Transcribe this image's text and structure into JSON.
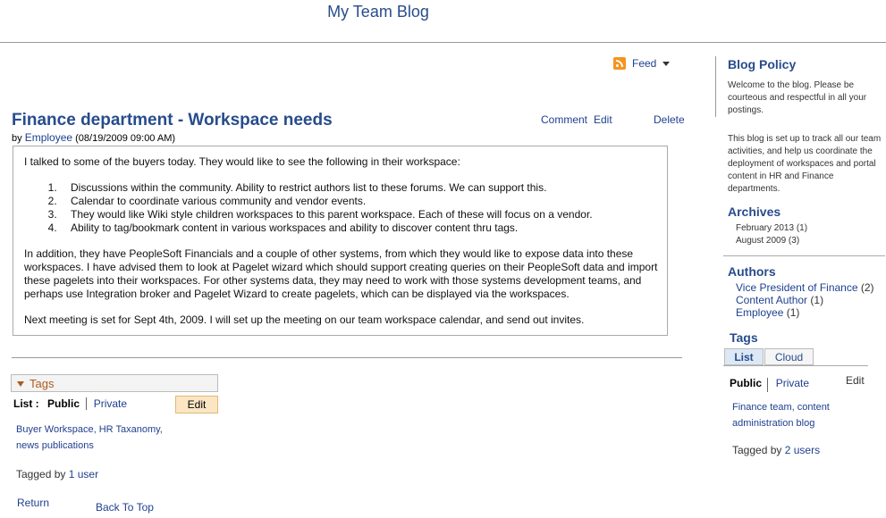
{
  "page": {
    "title": "My Team Blog"
  },
  "feed": {
    "label": "Feed"
  },
  "post": {
    "title": "Finance department - Workspace needs",
    "actions": {
      "comment": "Comment",
      "edit": "Edit",
      "delete": "Delete"
    },
    "byline": {
      "prefix": "by",
      "author": "Employee",
      "date": "(08/19/2009 09:00 AM)"
    },
    "body": {
      "intro": "I talked to some of the buyers today. They would like to see the following in their workspace:",
      "items": [
        "Discussions within the community. Ability to restrict authors list to these forums. We can support this.",
        "Calendar to coordinate various community and vendor events.",
        "They would like Wiki style children workspaces to this parent workspace. Each of these will focus on a vendor.",
        "Ability to tag/bookmark content in various workspaces and ability to discover content thru tags."
      ],
      "para2": "In addition, they have PeopleSoft Financials and a couple of other systems, from which they would like to expose data into these workspaces. I have advised them to look at Pagelet wizard which should support creating queries on their PeopleSoft data and import these pagelets into their workspaces. For other systems data, they may need to work with those systems development teams, and perhaps use Integration broker  and Pagelet Wizard to create pagelets, which can be displayed via the workspaces.",
      "para3": "Next meeting is set for Sept 4th, 2009. I will set up the meeting on our team workspace calendar, and send out invites."
    }
  },
  "tags": {
    "header": "Tags",
    "list_label": "List :",
    "public": "Public",
    "private": "Private",
    "edit": "Edit",
    "links": [
      "Buyer Workspace",
      "HR Taxanomy",
      "news publications"
    ],
    "tagged_prefix": "Tagged by",
    "tagged_link": "1 user"
  },
  "nav": {
    "return": "Return",
    "back_to_top": "Back To Top"
  },
  "rail": {
    "policy": {
      "title": "Blog Policy",
      "p1": "Welcome to the blog.  Please be courteous and respectful in all your postings.",
      "p2": "This blog is set up to track all our team activities, and help us coordinate the deployment of workspaces and portal content in HR and Finance departments."
    },
    "archives": {
      "title": "Archives",
      "items": [
        "February 2013 (1)",
        "August 2009 (3)"
      ]
    },
    "authors": {
      "title": "Authors",
      "items": [
        {
          "name": "Vice President of Finance",
          "count": "(2)"
        },
        {
          "name": "Content Author",
          "count": "(1)"
        },
        {
          "name": "Employee",
          "count": "(1)"
        }
      ]
    },
    "tags": {
      "title": "Tags",
      "tab_list": "List",
      "tab_cloud": "Cloud",
      "public": "Public",
      "private": "Private",
      "edit": "Edit",
      "links": [
        "Finance team",
        "content administration blog"
      ],
      "tagged_prefix": "Tagged by",
      "tagged_link": "2 users"
    }
  }
}
